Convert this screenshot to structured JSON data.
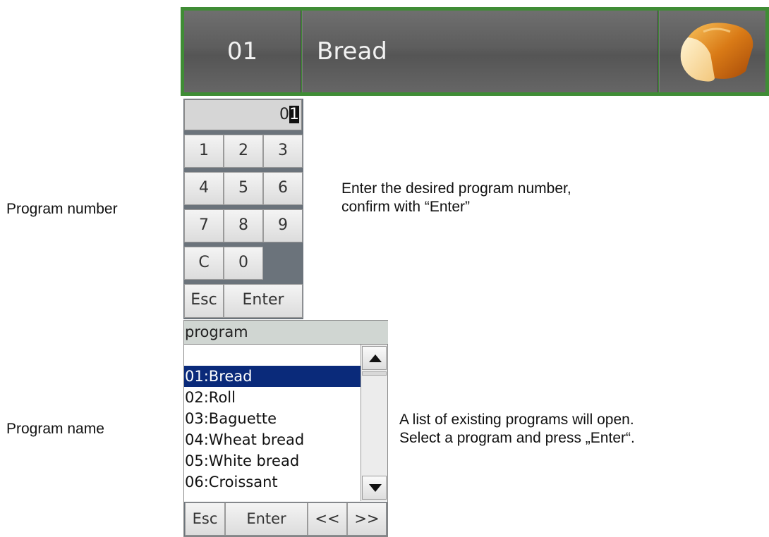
{
  "header": {
    "program_number": "01",
    "program_name": "Bread",
    "image_icon": "bread-loaf-icon"
  },
  "keypad": {
    "display_value_prefix": "0",
    "display_cursor_char": "1",
    "keys": [
      "1",
      "2",
      "3",
      "4",
      "5",
      "6",
      "7",
      "8",
      "9",
      "C",
      "0"
    ],
    "esc_label": "Esc",
    "enter_label": "Enter"
  },
  "program_list": {
    "title": "program",
    "items": [
      "01:Bread",
      "02:Roll",
      "03:Baguette",
      "04:Wheat bread",
      "05:White bread",
      "06:Croissant"
    ],
    "selected_index": 0,
    "esc_label": "Esc",
    "enter_label": "Enter",
    "prev_label": "<<",
    "next_label": ">>"
  },
  "labels": {
    "program_number": "Program number",
    "program_name": "Program name"
  },
  "instructions": {
    "program_number": "Enter the desired program number, confirm with “Enter”",
    "program_name_line1": "A list of existing programs will open.",
    "program_name_line2": "Select a program and press „Enter“."
  },
  "colors": {
    "header_border": "#3f8c35",
    "selection": "#0a2a7a"
  }
}
